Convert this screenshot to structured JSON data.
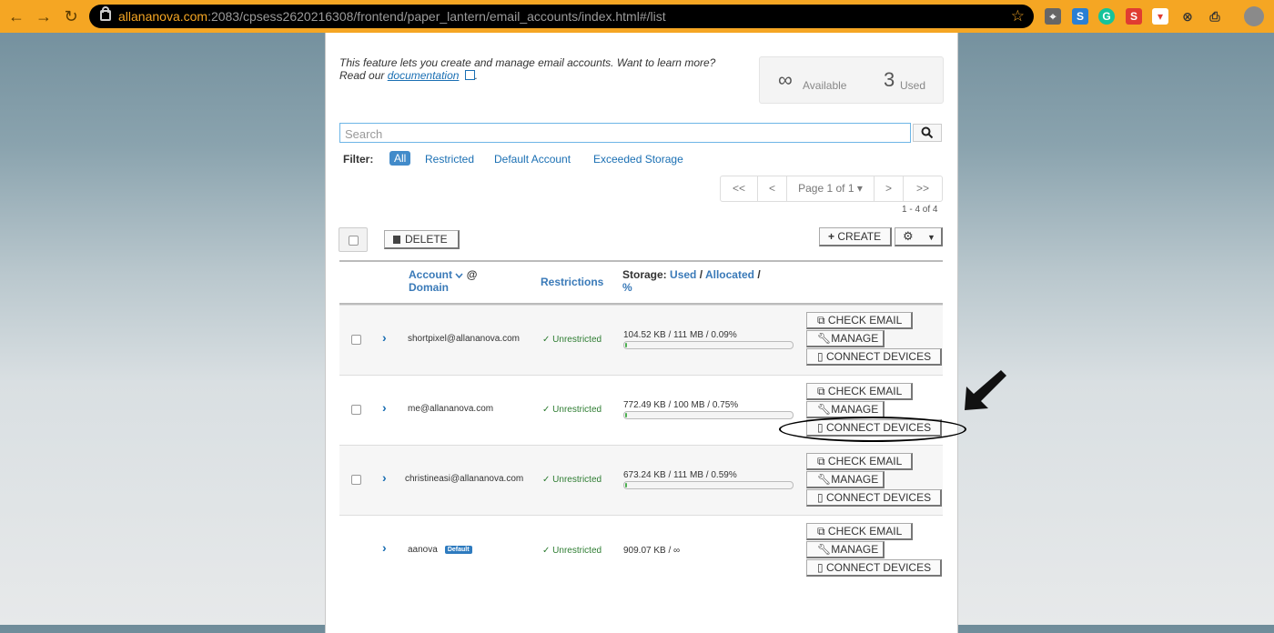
{
  "browser": {
    "url_host": "allananova.com",
    "url_rest": ":2083/cpsess2620216308/frontend/paper_lantern/email_accounts/index.html#/list",
    "extensions": [
      "map-icon",
      "s-blue-icon",
      "grammarly-icon",
      "s-red-icon",
      "pocket-icon",
      "close-circle-icon",
      "printer-icon",
      "avatar"
    ]
  },
  "intro": {
    "text": "This feature lets you create and manage email accounts. Want to learn more? Read our",
    "link": "documentation",
    "suffix": "."
  },
  "stats": {
    "available_symbol": "∞",
    "available_label": "Available",
    "used_value": "3",
    "used_label": "Used"
  },
  "search": {
    "placeholder": "Search"
  },
  "filter": {
    "label": "Filter:",
    "options": [
      "All",
      "Restricted",
      "Default Account",
      "Exceeded Storage"
    ],
    "active": "All"
  },
  "pagination": {
    "first": "<<",
    "prev": "<",
    "page": "Page 1 of 1",
    "next": ">",
    "last": ">>",
    "count": "1 - 4 of 4"
  },
  "toolbar": {
    "delete": "DELETE",
    "create": "CREATE"
  },
  "table": {
    "col_account": "Account",
    "col_at": "@",
    "col_domain": "Domain",
    "col_restrictions": "Restrictions",
    "col_storage": "Storage:",
    "col_used": "Used",
    "col_slash1": "/",
    "col_allocated": "Allocated",
    "col_slash2": "/",
    "col_percent": "%"
  },
  "rows": [
    {
      "email": "shortpixel@allananova.com",
      "restriction": "Unrestricted",
      "storage": "104.52 KB / 111 MB / 0.09%",
      "usage_fraction": 0.0009
    },
    {
      "email": "me@allananova.com",
      "restriction": "Unrestricted",
      "storage": "772.49 KB / 100 MB / 0.75%",
      "usage_fraction": 0.0075
    },
    {
      "email": "christineasi@allananova.com",
      "restriction": "Unrestricted",
      "storage": "673.24 KB / 111 MB / 0.59%",
      "usage_fraction": 0.0059
    },
    {
      "email": "aanova",
      "badge": "Default",
      "restriction": "Unrestricted",
      "storage": "909.07 KB / ∞"
    }
  ],
  "actions": {
    "check": "CHECK EMAIL",
    "manage": "MANAGE",
    "connect": "CONNECT DEVICES"
  }
}
